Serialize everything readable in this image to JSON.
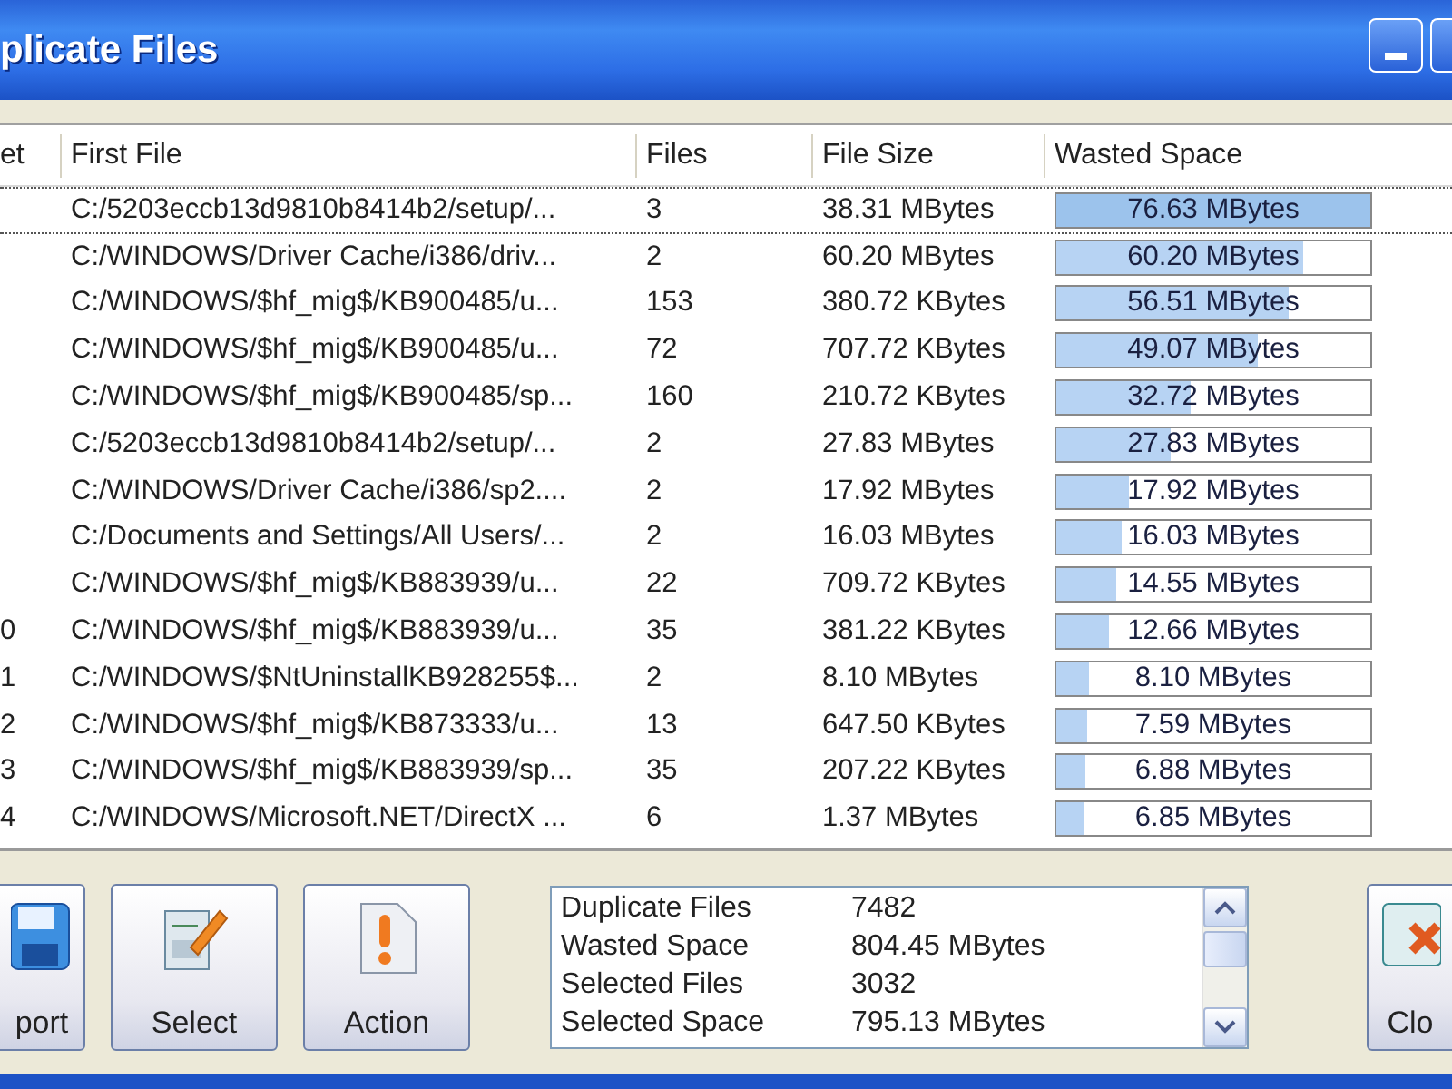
{
  "window": {
    "title": "plicate Files"
  },
  "table": {
    "columns": [
      "et",
      "First File",
      "Files",
      "File Size",
      "Wasted Space"
    ],
    "rows": [
      {
        "first_file": "C:/5203eccb13d9810b8414b2/setup/...",
        "files": "3",
        "file_size": "38.31 MBytes",
        "wasted_space": "76.63 MBytes",
        "level": 1,
        "selected": true
      },
      {
        "first_file": "C:/WINDOWS/Driver Cache/i386/driv...",
        "files": "2",
        "file_size": "60.20 MBytes",
        "wasted_space": "60.20 MBytes",
        "level": 0.786,
        "selected": false
      },
      {
        "first_file": "C:/WINDOWS/$hf_mig$/KB900485/u...",
        "files": "153",
        "file_size": "380.72 KBytes",
        "wasted_space": "56.51 MBytes",
        "level": 0.737,
        "selected": false
      },
      {
        "first_file": "C:/WINDOWS/$hf_mig$/KB900485/u...",
        "files": "72",
        "file_size": "707.72 KBytes",
        "wasted_space": "49.07 MBytes",
        "level": 0.64,
        "selected": false
      },
      {
        "first_file": "C:/WINDOWS/$hf_mig$/KB900485/sp...",
        "files": "160",
        "file_size": "210.72 KBytes",
        "wasted_space": "32.72 MBytes",
        "level": 0.427,
        "selected": false
      },
      {
        "first_file": "C:/5203eccb13d9810b8414b2/setup/...",
        "files": "2",
        "file_size": "27.83 MBytes",
        "wasted_space": "27.83 MBytes",
        "level": 0.363,
        "selected": false
      },
      {
        "first_file": "C:/WINDOWS/Driver Cache/i386/sp2....",
        "files": "2",
        "file_size": "17.92 MBytes",
        "wasted_space": "17.92 MBytes",
        "level": 0.234,
        "selected": false
      },
      {
        "first_file": "C:/Documents and Settings/All Users/...",
        "files": "2",
        "file_size": "16.03 MBytes",
        "wasted_space": "16.03 MBytes",
        "level": 0.209,
        "selected": false
      },
      {
        "first_file": "C:/WINDOWS/$hf_mig$/KB883939/u...",
        "files": "22",
        "file_size": "709.72 KBytes",
        "wasted_space": "14.55 MBytes",
        "level": 0.19,
        "selected": false
      },
      {
        "set": "0",
        "first_file": "C:/WINDOWS/$hf_mig$/KB883939/u...",
        "files": "35",
        "file_size": "381.22 KBytes",
        "wasted_space": "12.66 MBytes",
        "level": 0.165,
        "selected": false
      },
      {
        "set": "1",
        "first_file": "C:/WINDOWS/$NtUninstallKB928255$...",
        "files": "2",
        "file_size": "8.10 MBytes",
        "wasted_space": "8.10 MBytes",
        "level": 0.106,
        "selected": false
      },
      {
        "set": "2",
        "first_file": "C:/WINDOWS/$hf_mig$/KB873333/u...",
        "files": "13",
        "file_size": "647.50 KBytes",
        "wasted_space": "7.59 MBytes",
        "level": 0.099,
        "selected": false
      },
      {
        "set": "3",
        "first_file": "C:/WINDOWS/$hf_mig$/KB883939/sp...",
        "files": "35",
        "file_size": "207.22 KBytes",
        "wasted_space": "6.88 MBytes",
        "level": 0.09,
        "selected": false
      },
      {
        "set": "4",
        "first_file": "C:/WINDOWS/Microsoft.NET/DirectX ...",
        "files": "6",
        "file_size": "1.37 MBytes",
        "wasted_space": "6.85 MBytes",
        "level": 0.089,
        "selected": false
      }
    ]
  },
  "buttons": [
    {
      "label": "port",
      "kind": "disk"
    },
    {
      "label": "Select",
      "kind": "select"
    },
    {
      "label": "Action",
      "kind": "action"
    }
  ],
  "summary": [
    {
      "label": "Duplicate Files",
      "value": "7482"
    },
    {
      "label": "Wasted Space",
      "value": "804.45 MBytes"
    },
    {
      "label": "Selected Files",
      "value": "3032"
    },
    {
      "label": "Selected Space",
      "value": "795.13 MBytes"
    }
  ],
  "close_button": {
    "label": "Clo",
    "kind": "close"
  }
}
